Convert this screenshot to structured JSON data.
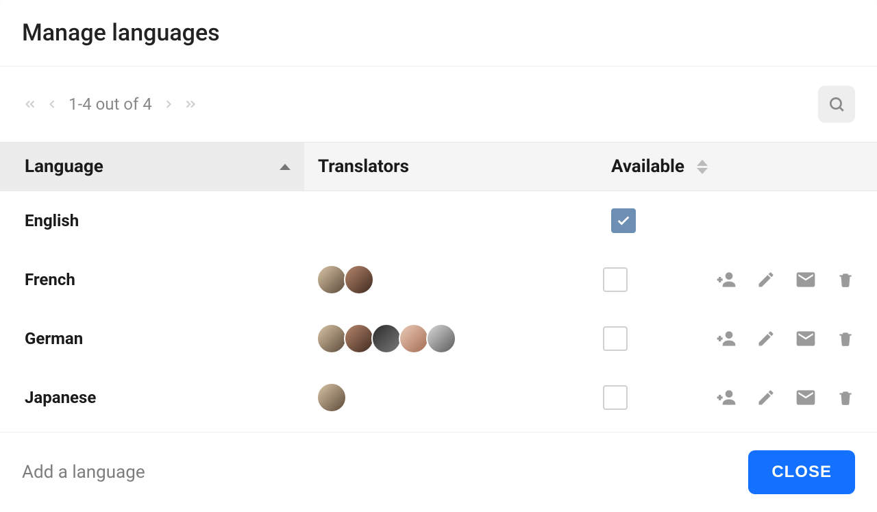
{
  "title": "Manage languages",
  "pager": {
    "text": "1-4 out of 4"
  },
  "columns": {
    "language": "Language",
    "translators": "Translators",
    "available": "Available"
  },
  "rows": [
    {
      "language": "English",
      "translators": 0,
      "available": true,
      "actions": false
    },
    {
      "language": "French",
      "translators": 2,
      "available": false,
      "actions": true
    },
    {
      "language": "German",
      "translators": 5,
      "available": false,
      "actions": true
    },
    {
      "language": "Japanese",
      "translators": 1,
      "available": false,
      "actions": true
    }
  ],
  "footer": {
    "add_label": "Add a language",
    "close_label": "CLOSE"
  },
  "avatar_gradients": [
    "linear-gradient(135deg,#d9c4a5,#5b4a39)",
    "linear-gradient(135deg,#b8866b,#3e2a20)",
    "linear-gradient(135deg,#2b2b2b,#7a7a7a)",
    "linear-gradient(135deg,#eacbb8,#a46b52)",
    "linear-gradient(135deg,#d8d8d8,#5a5a5a)"
  ]
}
